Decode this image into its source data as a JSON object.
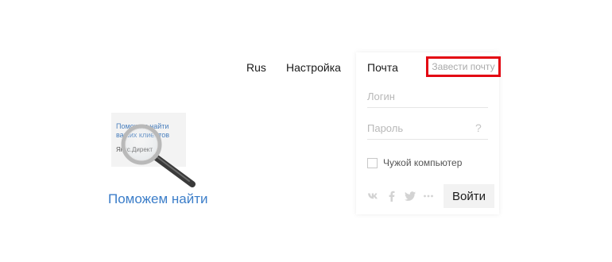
{
  "header": {
    "language_label": "Rus",
    "settings_label": "Настройка"
  },
  "login_panel": {
    "tab_mail_label": "Почта",
    "register_label": "Завести почту",
    "login_placeholder": "Логин",
    "password_placeholder": "Пароль",
    "help_label": "?",
    "remember_label": "Чужой компьютер",
    "remember_checked": false,
    "social_icons": [
      "vk-icon",
      "facebook-icon",
      "twitter-icon",
      "more-icon"
    ],
    "submit_label": "Войти",
    "highlight_color": "#e30613"
  },
  "promo": {
    "card_text": "Поможем найти ваших клиентов",
    "card_brand": "Янкс.Директ",
    "heading": "Поможем найти"
  }
}
